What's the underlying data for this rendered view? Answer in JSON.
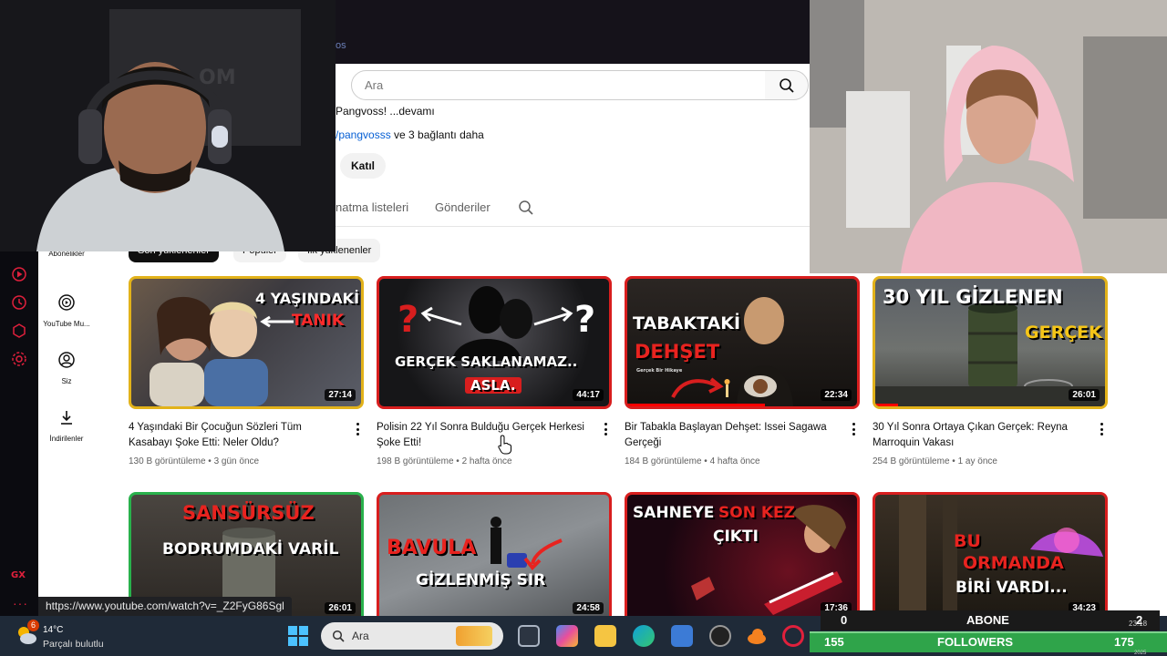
{
  "header": {
    "partial_text": "os",
    "search_placeholder": "Ara"
  },
  "channel": {
    "description_line": "Pangvoss! ...devamı",
    "links_handle": "/pangvosss",
    "links_more": " ve 3 bağlantı daha",
    "join_label": "Katıl"
  },
  "tabs": {
    "playlists": "natma listeleri",
    "posts": "Gönderiler"
  },
  "chips": [
    "Son yüklenenler",
    "Popüler",
    "İlk yüklenenler"
  ],
  "guide": {
    "items": [
      {
        "label": "Abonelikler",
        "icon": "subscriptions-icon"
      },
      {
        "label": "YouTube Mu...",
        "icon": "youtube-music-icon"
      },
      {
        "label": "Siz",
        "icon": "account-icon"
      },
      {
        "label": "İndirilenler",
        "icon": "download-icon"
      }
    ]
  },
  "videos": [
    {
      "title": "4 Yaşındaki Bir Çocuğun Sözleri Tüm Kasabayı Şoke Etti: Neler Oldu?",
      "views": "130 B görüntüleme",
      "age": "3 gün önce",
      "duration": "27:14",
      "thumb_text": [
        "4 YAŞINDAKİ",
        "TANIK"
      ]
    },
    {
      "title": "Polisin 22 Yıl Sonra Bulduğu Gerçek Herkesi Şoke Etti!",
      "views": "198 B görüntüleme",
      "age": "2 hafta önce",
      "duration": "44:17",
      "thumb_text": [
        "GERÇEK SAKLANAMAZ..",
        "ASLA."
      ]
    },
    {
      "title": "Bir Tabakla Başlayan Dehşet: Issei Sagawa Gerçeği",
      "views": "184 B görüntüleme",
      "age": "4 hafta önce",
      "duration": "22:34",
      "thumb_text": [
        "TABAKTAKİ",
        "DEHŞET",
        "Gerçek Bir Hikaye"
      ]
    },
    {
      "title": "30 Yıl Sonra Ortaya Çıkan Gerçek: Reyna Marroquin Vakası",
      "views": "254 B görüntüleme",
      "age": "1 ay önce",
      "duration": "26:01",
      "thumb_text": [
        "30 YIL GİZLENEN",
        "GERÇEK"
      ]
    },
    {
      "duration": "26:01",
      "thumb_text": [
        "SANSÜRSÜZ",
        "BODRUMDAKİ VARİL"
      ]
    },
    {
      "duration": "24:58",
      "thumb_text": [
        "BAVULA",
        "GİZLENMİŞ SIR"
      ]
    },
    {
      "duration": "17:36",
      "thumb_text": [
        "SAHNEYE",
        "SON KEZ",
        "ÇIKTI"
      ]
    },
    {
      "duration": "34:23",
      "thumb_text": [
        "BU",
        "ORMANDA",
        "BİRİ VARDI..."
      ]
    }
  ],
  "status_url": "https://www.youtube.com/watch?v=_Z2FyG86Sgl",
  "taskbar": {
    "weather_badge": "6",
    "temperature": "14°C",
    "weather": "Parçalı bulutlu",
    "search_placeholder": "Ara",
    "time_partial": "23:18",
    "date_partial": "2025"
  },
  "overlay": {
    "abone_label": "ABONE",
    "abone_current": "0",
    "abone_goal": "2",
    "followers_label": "FOLLOWERS",
    "followers_current": "155",
    "followers_goal": "175"
  },
  "colors": {
    "gx_accent": "#e0203c",
    "thumb_red": "#d81e1e",
    "thumb_gold": "#e2b21a",
    "thumb_green": "#29b14c",
    "overlay_green": "#2fa44a"
  }
}
